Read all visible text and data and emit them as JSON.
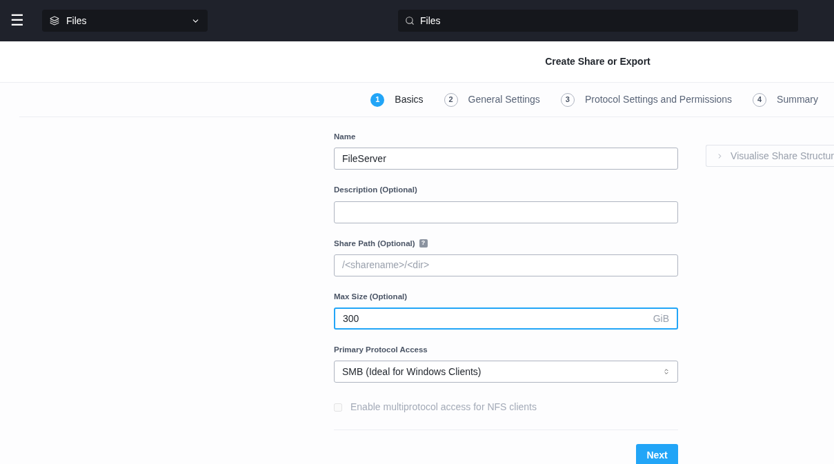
{
  "header": {
    "menu_icon": "☰",
    "module": "Files",
    "search": {
      "value": "Files"
    }
  },
  "page_title": "Create Share or Export",
  "steps": [
    {
      "number": "1",
      "label": "Basics",
      "selected": true
    },
    {
      "number": "2",
      "label": "General Settings",
      "selected": false
    },
    {
      "number": "3",
      "label": "Protocol Settings and Permissions",
      "selected": false
    },
    {
      "number": "4",
      "label": "Summary",
      "selected": false
    }
  ],
  "fields": [
    {
      "kind": "text",
      "label": "Name",
      "value": "FileServer",
      "focused": false
    },
    {
      "kind": "text",
      "label": "Description (Optional)",
      "focused": false
    },
    {
      "kind": "text",
      "label": "Share Path (Optional)",
      "help": "?",
      "placeholder": "/<sharename>/<dir>",
      "focused": false
    },
    {
      "kind": "text",
      "label": "Max Size (Optional)",
      "value": "300",
      "unit": "GiB",
      "focused": true
    },
    {
      "kind": "select",
      "label": "Primary Protocol Access",
      "value": "SMB (Ideal for Windows Clients)"
    },
    {
      "kind": "checkbox",
      "label": "Enable multiprotocol access for NFS clients",
      "checked": false,
      "disabled": true
    }
  ],
  "next_button": "Next",
  "visualise_button": "Visualise Share Structur"
}
